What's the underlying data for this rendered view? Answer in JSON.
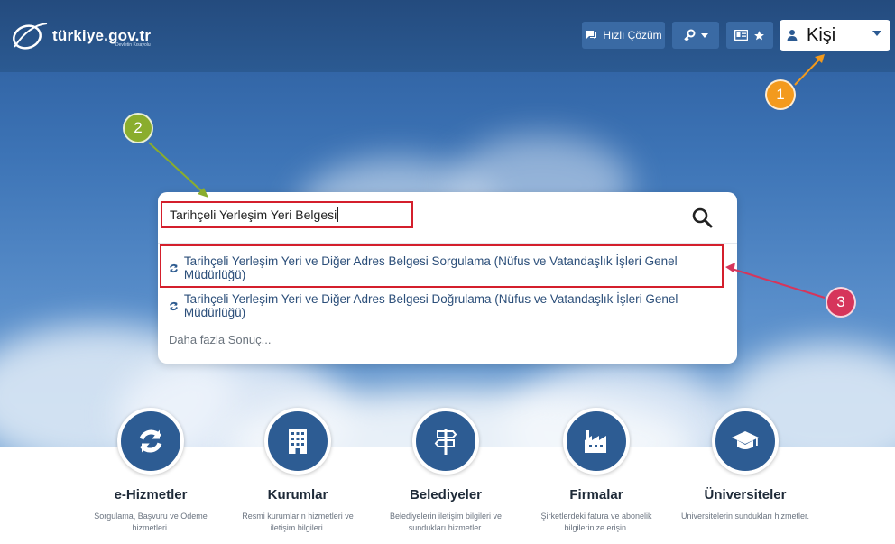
{
  "header": {
    "logo_text": "türkiye.gov.tr",
    "logo_sub": "Devletin Kısayolu",
    "quick_solution_label": "Hızlı Çözüm",
    "user_label": "Kişi"
  },
  "search": {
    "query": "Tarihçeli Yerleşim Yeri Belgesi",
    "results": [
      "Tarihçeli Yerleşim Yeri ve Diğer Adres Belgesi Sorgulama (Nüfus ve Vatandaşlık İşleri Genel Müdürlüğü)",
      "Tarihçeli Yerleşim Yeri ve Diğer Adres Belgesi Doğrulama (Nüfus ve Vatandaşlık İşleri Genel Müdürlüğü)"
    ],
    "more_label": "Daha fazla Sonuç..."
  },
  "annotations": {
    "marker_1": "1",
    "marker_2": "2",
    "marker_3": "3"
  },
  "categories": [
    {
      "title": "e-Hizmetler",
      "desc": "Sorgulama, Başvuru ve Ödeme hizmetleri.",
      "icon": "refresh-icon"
    },
    {
      "title": "Kurumlar",
      "desc": "Resmi kurumların hizmetleri ve iletişim bilgileri.",
      "icon": "building-icon"
    },
    {
      "title": "Belediyeler",
      "desc": "Belediyelerin iletişim bilgileri ve sundukları hizmetler.",
      "icon": "signpost-icon"
    },
    {
      "title": "Firmalar",
      "desc": "Şirketlerdeki fatura ve abonelik bilgilerinize erişin.",
      "icon": "factory-icon"
    },
    {
      "title": "Üniversiteler",
      "desc": "Üniversitelerin sundukları hizmetler.",
      "icon": "graduation-cap-icon"
    }
  ],
  "colors": {
    "brand_blue": "#2b5a92",
    "highlight_red": "#d41f2c",
    "marker_orange": "#f39a1d",
    "marker_green": "#8aad2d",
    "marker_pink": "#d6355b"
  }
}
